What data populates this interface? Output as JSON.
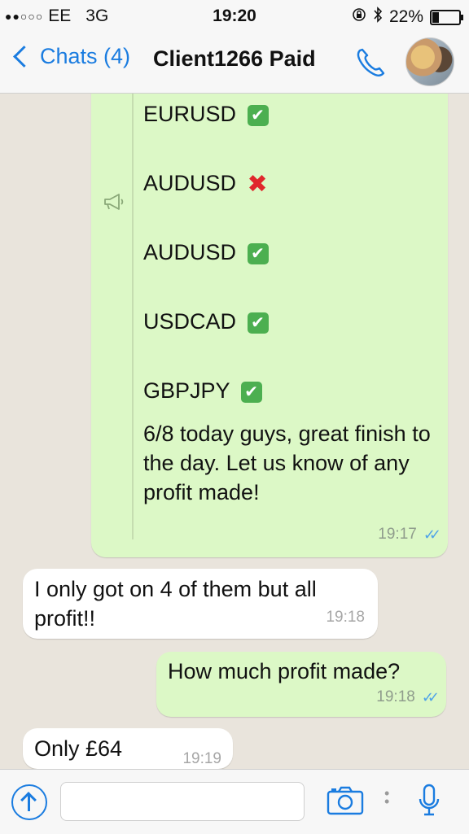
{
  "status_bar": {
    "signal": "●●○○○",
    "carrier": "EE",
    "network": "3G",
    "time": "19:20",
    "battery": "22%"
  },
  "header": {
    "back_label": "Chats (4)",
    "title": "Client1266 Paid",
    "icons": [
      "chevron-left-icon",
      "phone-icon",
      "avatar"
    ]
  },
  "messages": {
    "broadcast": {
      "lines": [
        {
          "pair": "EURUSD",
          "result": "✔"
        },
        {
          "pair": "AUDUSD",
          "result": "✖"
        },
        {
          "pair": "AUDUSD",
          "result": "✔"
        },
        {
          "pair": "USDCAD",
          "result": "✔"
        },
        {
          "pair": "GBPJPY",
          "result": "✔"
        }
      ],
      "summary": "6/8 today guys, great finish to the day. Let us know of any profit made!",
      "time": "19:17"
    },
    "incoming_1": {
      "text": "I only got on 4 of them but all profit!!",
      "time": "19:18"
    },
    "outgoing_1": {
      "text": "How much profit made?",
      "time": "19:18"
    },
    "incoming_2": {
      "text": "Only £64",
      "time": "19:19"
    }
  },
  "colors": {
    "accent": "#1a7ce0",
    "outgoing_bubble": "#dcf8c6",
    "incoming_bubble": "#ffffff",
    "chat_bg": "#e9e4dc",
    "read_ticks": "#4fa3e8"
  }
}
